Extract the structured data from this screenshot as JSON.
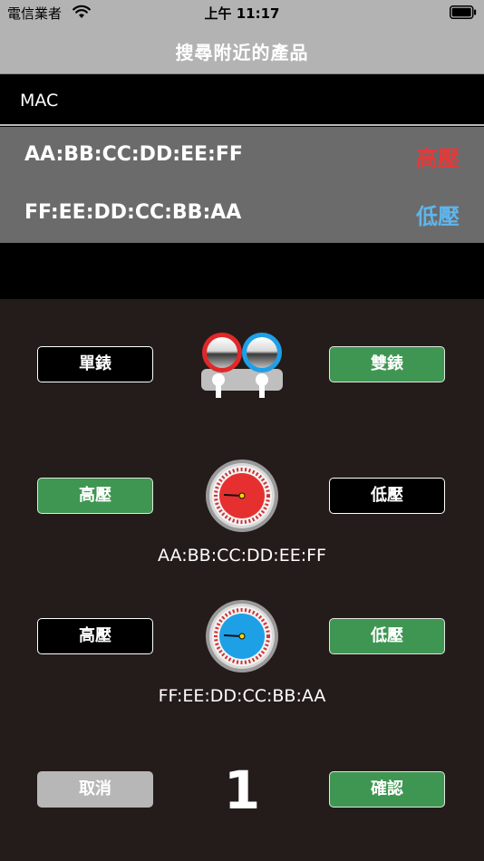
{
  "status": {
    "carrier": "電信業者",
    "time": "上午 11:17"
  },
  "nav": {
    "title": "搜尋附近的產品"
  },
  "list": {
    "header": "MAC",
    "devices": [
      {
        "mac": "AA:BB:CC:DD:EE:FF",
        "tag": "高壓"
      },
      {
        "mac": "FF:EE:DD:CC:BB:AA",
        "tag": "低壓"
      }
    ]
  },
  "mode": {
    "single_label": "單錶",
    "double_label": "雙錶",
    "selected": "雙錶"
  },
  "gauge1": {
    "high_label": "高壓",
    "low_label": "低壓",
    "selected": "高壓",
    "mac": "AA:BB:CC:DD:EE:FF",
    "color": "#e63030"
  },
  "gauge2": {
    "high_label": "高壓",
    "low_label": "低壓",
    "selected": "低壓",
    "mac": "FF:EE:DD:CC:BB:AA",
    "color": "#1ea0e6"
  },
  "footer": {
    "cancel_label": "取消",
    "count": "1",
    "confirm_label": "確認"
  },
  "colors": {
    "green": "#3f9652",
    "panel": "#241c1a",
    "list_bg": "#6b6b6b",
    "high": "#e23a3a",
    "low": "#5fb5ec"
  }
}
